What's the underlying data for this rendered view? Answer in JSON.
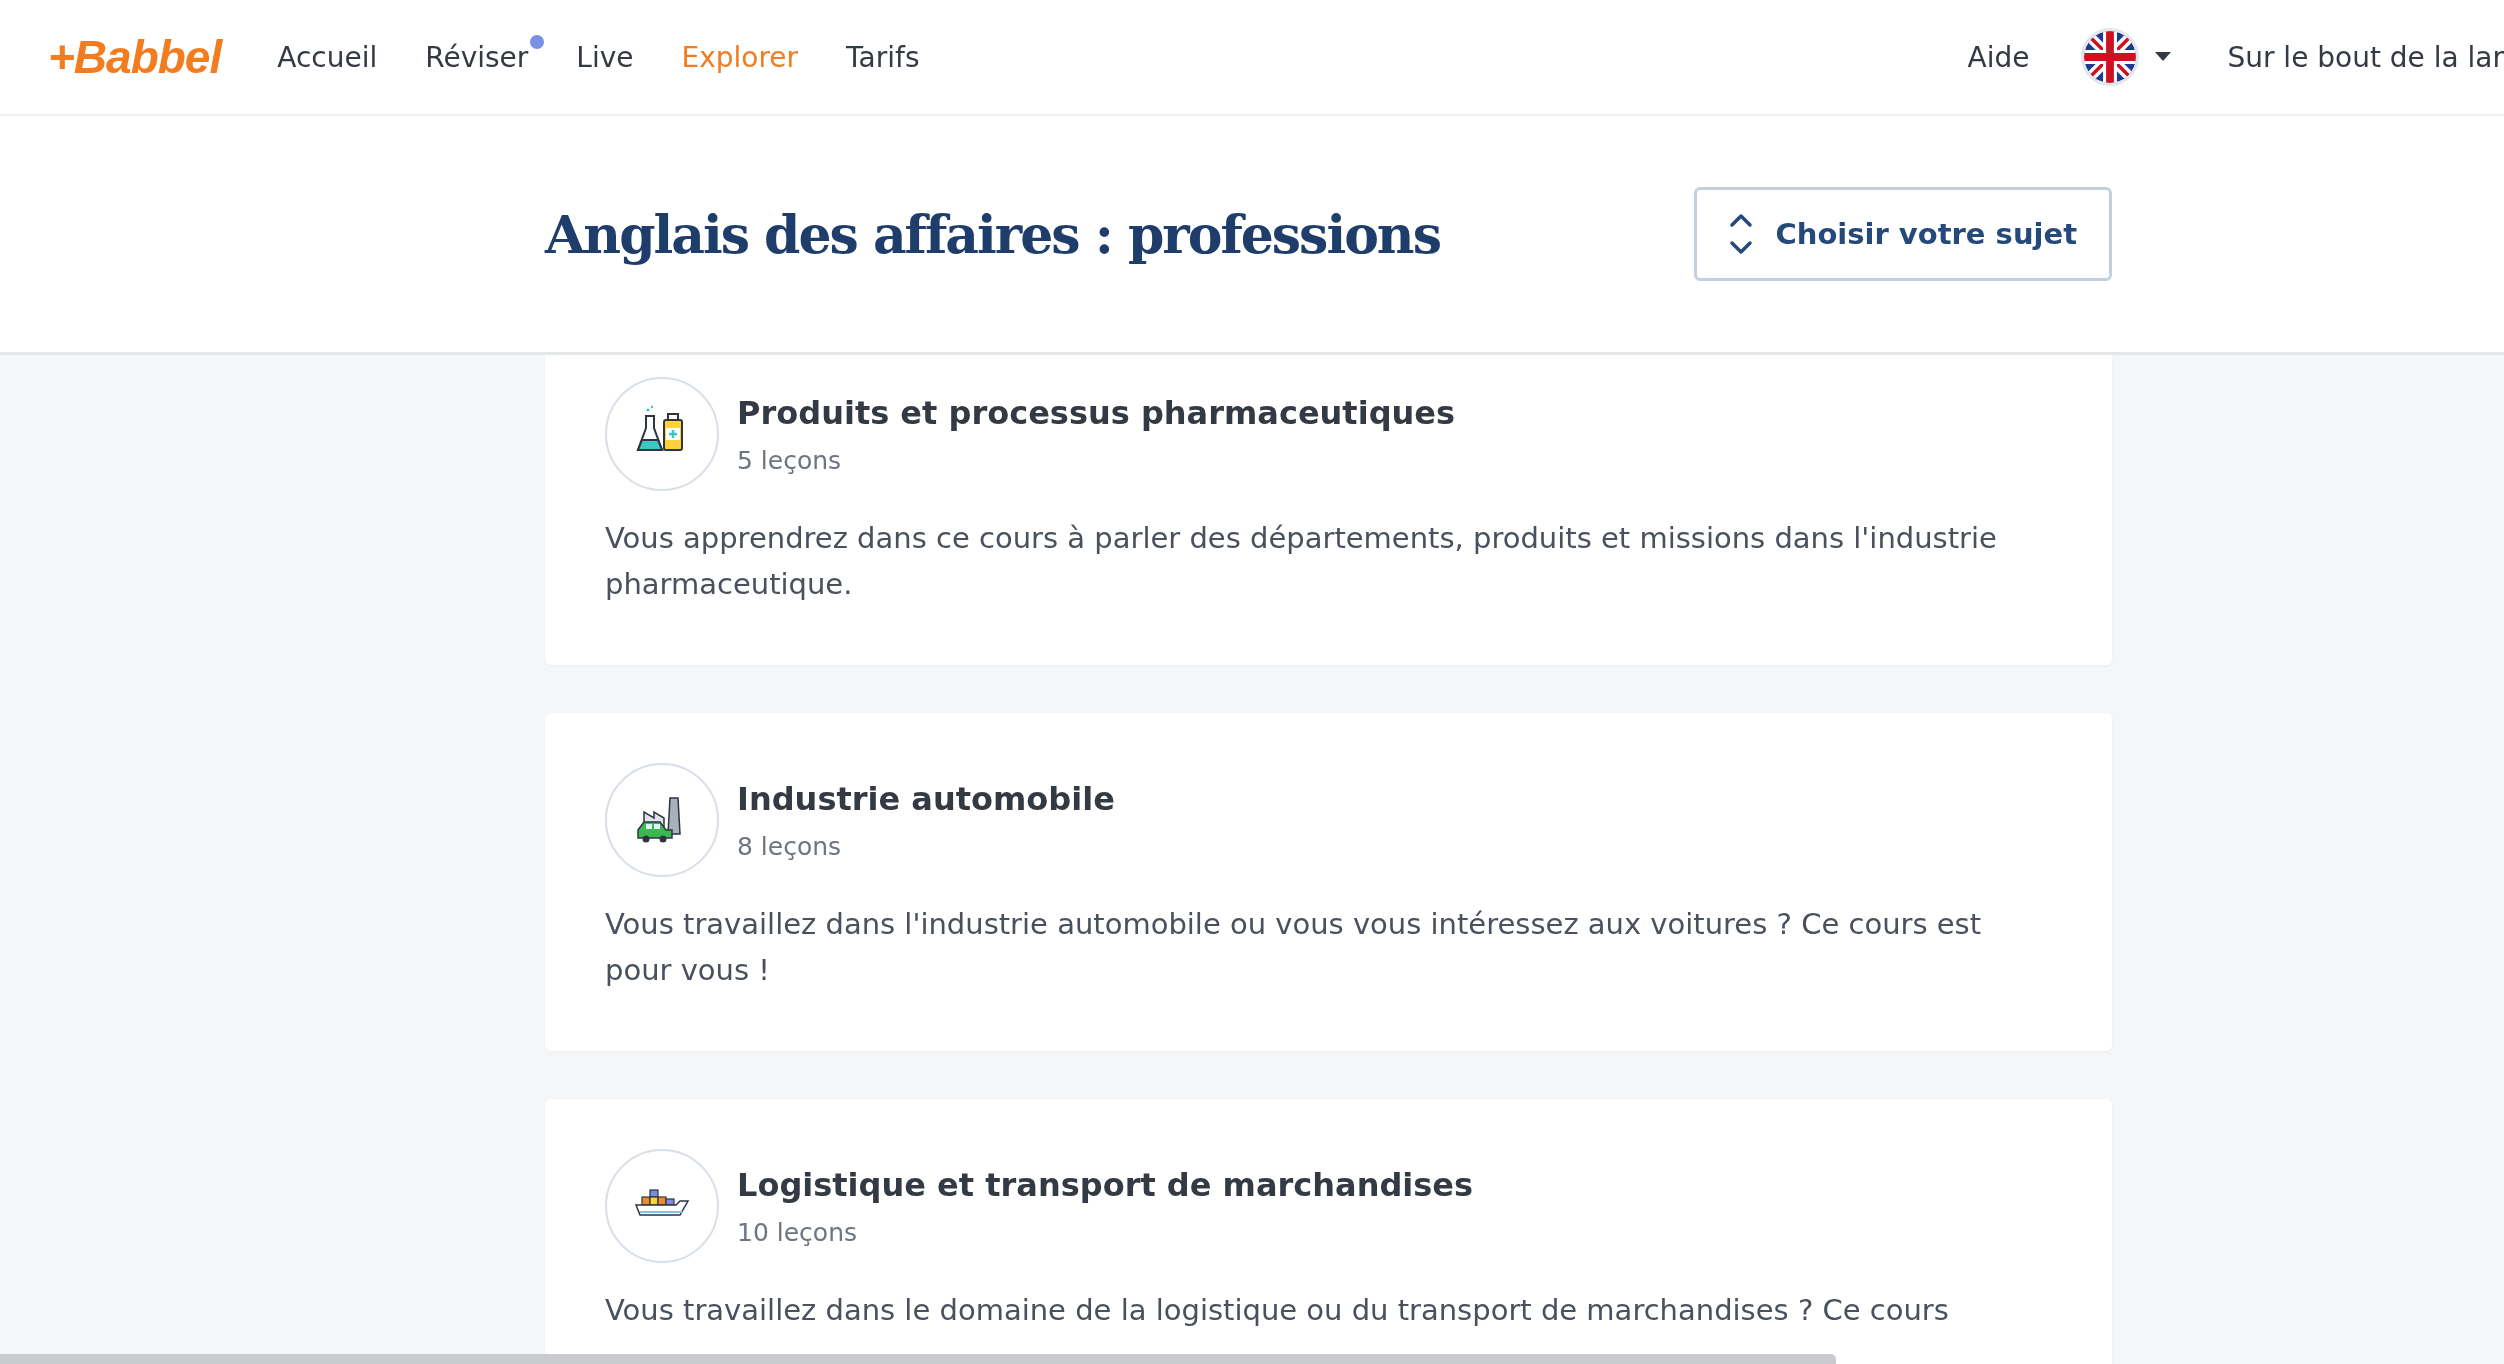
{
  "nav": {
    "logo": "+Babbel",
    "items": [
      {
        "label": "Accueil",
        "selected": false,
        "notification": false
      },
      {
        "label": "Réviser",
        "selected": false,
        "notification": true
      },
      {
        "label": "Live",
        "selected": false,
        "notification": false
      },
      {
        "label": "Explorer",
        "selected": true,
        "notification": false
      },
      {
        "label": "Tarifs",
        "selected": false,
        "notification": false
      }
    ],
    "help": "Aide",
    "account": "Sur le bout de la lar"
  },
  "page": {
    "title": "Anglais des affaires : professions",
    "topic_button": "Choisir votre sujet"
  },
  "courses": [
    {
      "kind": "pharma",
      "title": "Produits et processus pharmaceutiques",
      "lessons": "5 leçons",
      "description": "Vous apprendrez dans ce cours à parler des départements, produits et missions dans l'industrie pharmaceutique."
    },
    {
      "kind": "car",
      "title": "Industrie automobile",
      "lessons": "8 leçons",
      "description": "Vous travaillez dans l'industrie automobile ou vous vous intéressez aux voitures ? Ce cours est pour vous !"
    },
    {
      "kind": "ship",
      "title": "Logistique et transport de marchandises",
      "lessons": "10 leçons",
      "description": "Vous travaillez dans le domaine de la logistique ou du transport de marchandises ? Ce cours"
    }
  ]
}
